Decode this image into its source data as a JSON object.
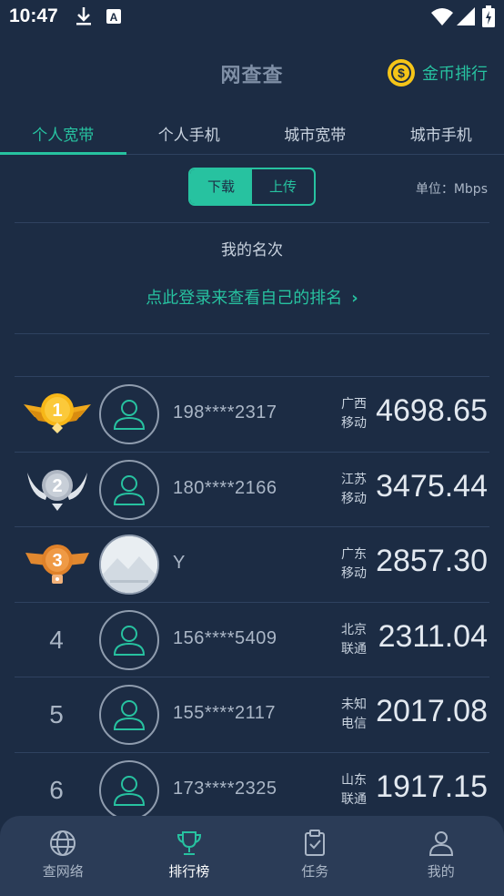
{
  "status_bar": {
    "time": "10:47",
    "icons": [
      "download-icon",
      "a-icon",
      "wifi-icon",
      "signal-icon",
      "battery-icon"
    ]
  },
  "header": {
    "title": "网查查",
    "coin_icon_glyph": "$",
    "coin_rank_label": "金币排行"
  },
  "tabs": [
    {
      "label": "个人宽带",
      "active": true
    },
    {
      "label": "个人手机",
      "active": false
    },
    {
      "label": "城市宽带",
      "active": false
    },
    {
      "label": "城市手机",
      "active": false
    }
  ],
  "direction": {
    "download": "下载",
    "upload": "上传",
    "selected": "download"
  },
  "unit_label": "单位：Mbps",
  "my_rank": {
    "title": "我的名次",
    "login_prompt": "点此登录来查看自己的排名",
    "chevron": "›"
  },
  "ranking": [
    {
      "rank": "1",
      "medal": "gold",
      "user": "198****2317",
      "region_line1": "广西",
      "region_line2": "移动",
      "speed": "4698.65"
    },
    {
      "rank": "2",
      "medal": "silver",
      "user": "180****2166",
      "region_line1": "江苏",
      "region_line2": "移动",
      "speed": "3475.44"
    },
    {
      "rank": "3",
      "medal": "bronze",
      "user": "Y",
      "region_line1": "广东",
      "region_line2": "移动",
      "speed": "2857.30"
    },
    {
      "rank": "4",
      "medal": null,
      "user": "156****5409",
      "region_line1": "北京",
      "region_line2": "联通",
      "speed": "2311.04"
    },
    {
      "rank": "5",
      "medal": null,
      "user": "155****2117",
      "region_line1": "未知",
      "region_line2": "电信",
      "speed": "2017.08"
    },
    {
      "rank": "6",
      "medal": null,
      "user": "173****2325",
      "region_line1": "山东",
      "region_line2": "联通",
      "speed": "1917.15"
    }
  ],
  "bottom_nav": [
    {
      "label": "查网络",
      "icon": "globe-icon",
      "active": false
    },
    {
      "label": "排行榜",
      "icon": "trophy-icon",
      "active": true
    },
    {
      "label": "任务",
      "icon": "clipboard-check-icon",
      "active": false
    },
    {
      "label": "我的",
      "icon": "user-icon",
      "active": false
    }
  ],
  "colors": {
    "background": "#1c2c44",
    "accent": "#27c2a0",
    "coin": "#f5c518",
    "nav_background": "#2b3c57"
  }
}
